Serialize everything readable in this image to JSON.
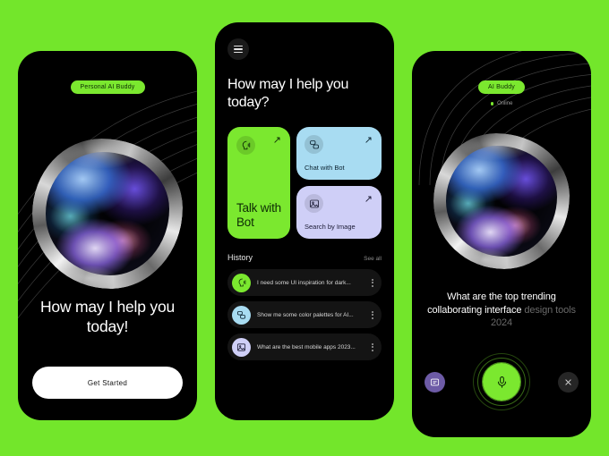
{
  "theme": {
    "background": "#73E62B",
    "accent_green": "#7BE82F",
    "phone_black": "#000000",
    "card_blue": "#A8DCF2",
    "card_lavender": "#CFCFF7",
    "purple_button": "#6D5BA6"
  },
  "screen_onboarding": {
    "badge": "Personal AI Buddy",
    "headline": "How may I help you today!",
    "cta_label": "Get Started"
  },
  "screen_home": {
    "menu_icon": "hamburger-menu-icon",
    "heading": "How may I help you today?",
    "cards": [
      {
        "label": "Talk with Bot",
        "icon": "voice-profile-icon",
        "arrow": "↗"
      },
      {
        "label": "Chat with Bot",
        "icon": "chat-bubbles-icon",
        "arrow": "↗"
      },
      {
        "label": "Search by Image",
        "icon": "image-icon",
        "arrow": "↗"
      }
    ],
    "history": {
      "title": "History",
      "see_all": "See all",
      "items": [
        {
          "text": "I need some UI inspiration for dark...",
          "icon": "voice-profile-icon"
        },
        {
          "text": "Show me some color palettes for AI...",
          "icon": "chat-bubbles-icon"
        },
        {
          "text": "What are the best mobile apps 2023...",
          "icon": "image-icon"
        }
      ]
    }
  },
  "screen_voice": {
    "badge": "AI Buddy",
    "status": "Online",
    "prompt_spoken": "What are the top trending collaborating interface ",
    "prompt_pending": "design tools 2024",
    "keyboard_button_icon": "keyboard-message-icon",
    "mic_button_icon": "microphone-icon",
    "close_button_icon": "close-icon"
  }
}
